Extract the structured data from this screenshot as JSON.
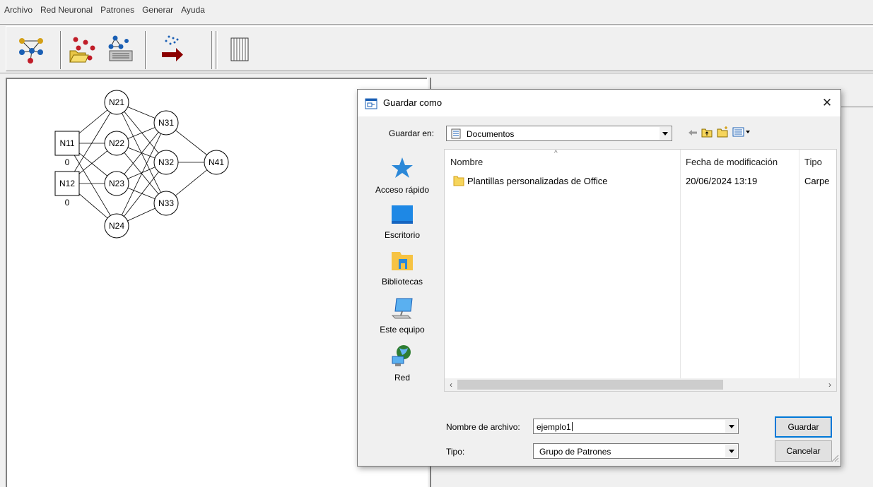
{
  "menu": [
    "Archivo",
    "Red Neuronal",
    "Patrones",
    "Generar",
    "Ayuda"
  ],
  "toolbar": {
    "icons": [
      "network-icon",
      "open-patterns-icon",
      "network-save-icon",
      "generate-icon",
      "grid-icon"
    ]
  },
  "network": {
    "nodes": [
      {
        "id": "N11",
        "shape": "square",
        "value": "0"
      },
      {
        "id": "N12",
        "shape": "square",
        "value": "0"
      },
      {
        "id": "N21",
        "shape": "circle"
      },
      {
        "id": "N22",
        "shape": "circle"
      },
      {
        "id": "N23",
        "shape": "circle"
      },
      {
        "id": "N24",
        "shape": "circle"
      },
      {
        "id": "N31",
        "shape": "circle"
      },
      {
        "id": "N32",
        "shape": "circle"
      },
      {
        "id": "N33",
        "shape": "circle"
      },
      {
        "id": "N41",
        "shape": "circle"
      }
    ]
  },
  "dialog": {
    "title": "Guardar como",
    "close_label": "✕",
    "save_in_label": "Guardar en:",
    "save_in_value": "Documentos",
    "places": [
      "Acceso rápido",
      "Escritorio",
      "Bibliotecas",
      "Este equipo",
      "Red"
    ],
    "columns": [
      "Nombre",
      "Fecha de modificación",
      "Tipo"
    ],
    "files": [
      {
        "name": "Plantillas personalizadas de Office",
        "modified": "20/06/2024 13:19",
        "type": "Carpe"
      }
    ],
    "filename_label": "Nombre de archivo:",
    "filename_value": "ejemplo1",
    "type_label": "Tipo:",
    "type_value": "Grupo de Patrones",
    "save_button": "Guardar",
    "cancel_button": "Cancelar"
  }
}
